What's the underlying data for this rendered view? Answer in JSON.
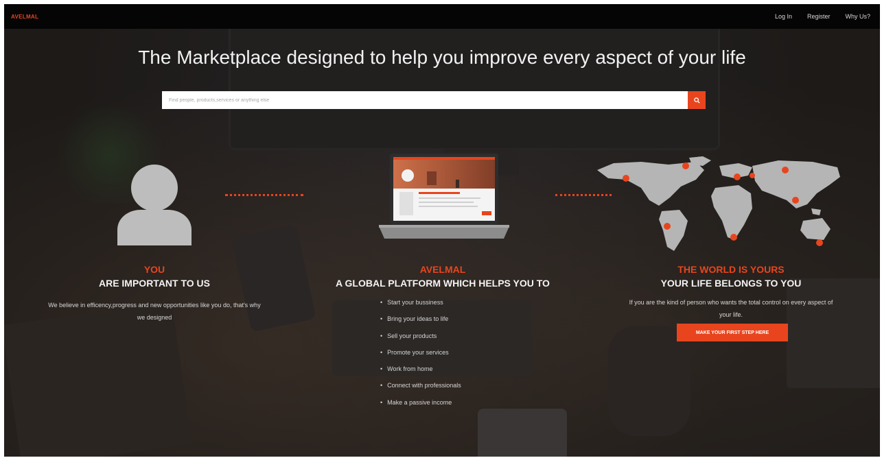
{
  "brand": "AVELMAL",
  "nav": {
    "login": "Log In",
    "register": "Register",
    "why": "Why Us?"
  },
  "hero": {
    "headline": "The Marketplace designed to help you improve every aspect of your life",
    "search_placeholder": "Find people, products,services or anything else"
  },
  "col1": {
    "title_accent": "YOU",
    "title": "ARE IMPORTANT TO US",
    "body_line1": "We believe in efficency,progress and new opportunities like you do, that's why",
    "body_line2": "we designed"
  },
  "col2": {
    "title_accent": "AVELMAL",
    "title": "A GLOBAL PLATFORM WHICH HELPS YOU TO",
    "bullets": [
      "Start your bussiness",
      "Bring your ideas to life",
      "Sell your products",
      "Promote your services",
      "Work from home",
      "Connect with professionals",
      "Make a passive income"
    ]
  },
  "col3": {
    "title_accent": "THE WORLD IS YOURS",
    "title": "YOUR LIFE BELONGS TO YOU",
    "body_line1": "If you are the kind of person who wants the total control on every aspect of",
    "body_line2": "your life.",
    "cta": "MAKE YOUR FIRST STEP HERE"
  },
  "colors": {
    "accent": "#e8451e",
    "topbar": "#050505",
    "background": "#1d1a18"
  },
  "icons": {
    "search_button": "search-icon",
    "col1": "user-avatar-icon",
    "col2": "laptop-icon",
    "col3": "world-map-icon"
  }
}
